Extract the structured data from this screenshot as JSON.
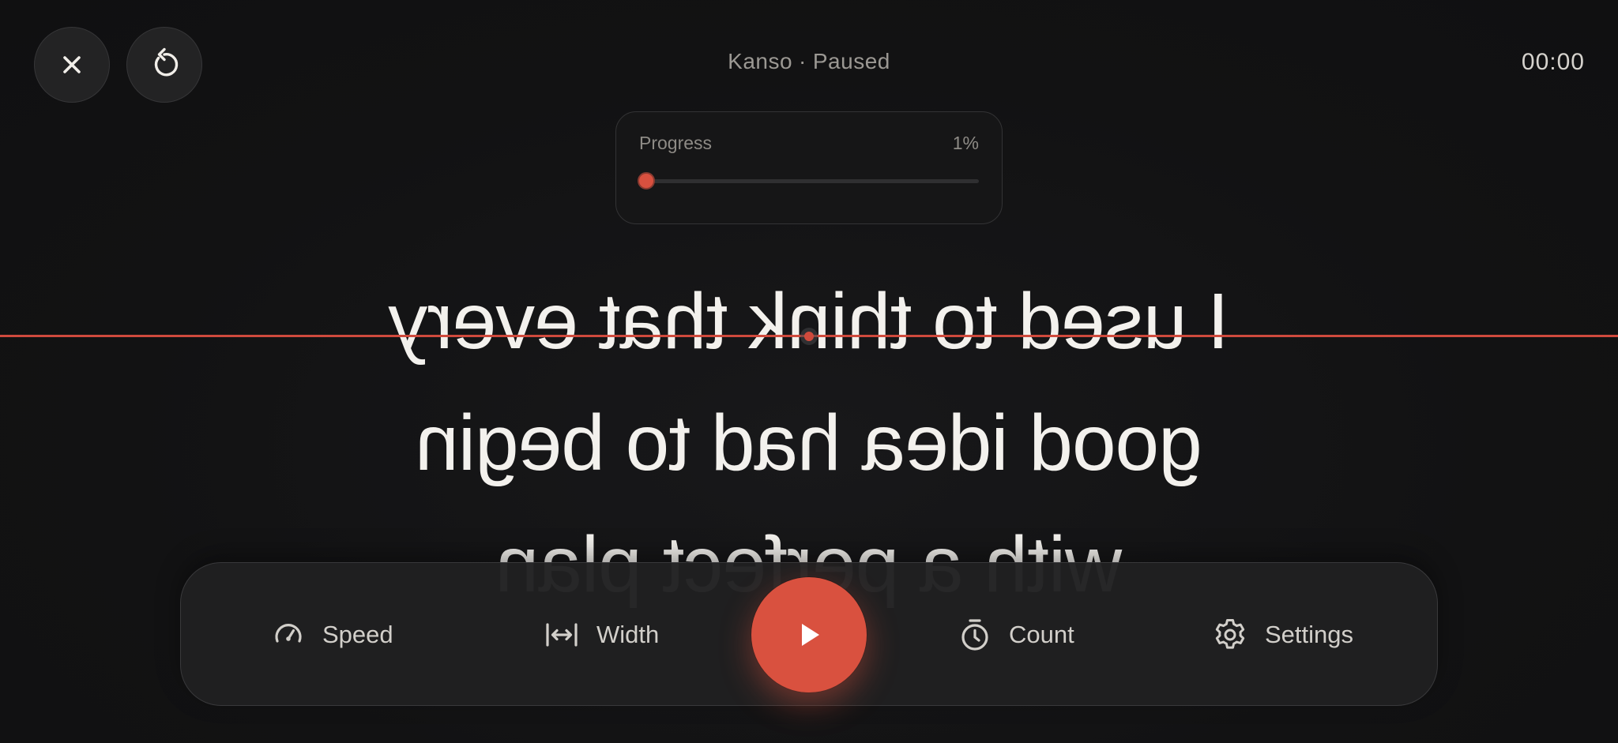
{
  "header": {
    "app_name": "Kanso",
    "separator": "·",
    "status": "Paused",
    "timer": "00:00"
  },
  "buttons": {
    "close_icon": "close-icon",
    "reset_icon": "reset-icon"
  },
  "progress": {
    "label": "Progress",
    "percent_text": "1%",
    "value": 0.01
  },
  "prompter": {
    "mirrored": true,
    "lines": [
      "I used to think that every",
      "good idea had to begin",
      "with a perfect plan"
    ]
  },
  "controls": {
    "speed": {
      "label": "Speed",
      "icon": "speedometer-icon"
    },
    "width": {
      "label": "Width",
      "icon": "width-arrows-icon"
    },
    "play": {
      "icon": "play-icon"
    },
    "count": {
      "label": "Count",
      "icon": "stopwatch-icon"
    },
    "settings": {
      "label": "Settings",
      "icon": "gear-icon"
    }
  },
  "colors": {
    "accent": "#d9513f",
    "background": "#121213",
    "text": "#f3f1ed"
  }
}
